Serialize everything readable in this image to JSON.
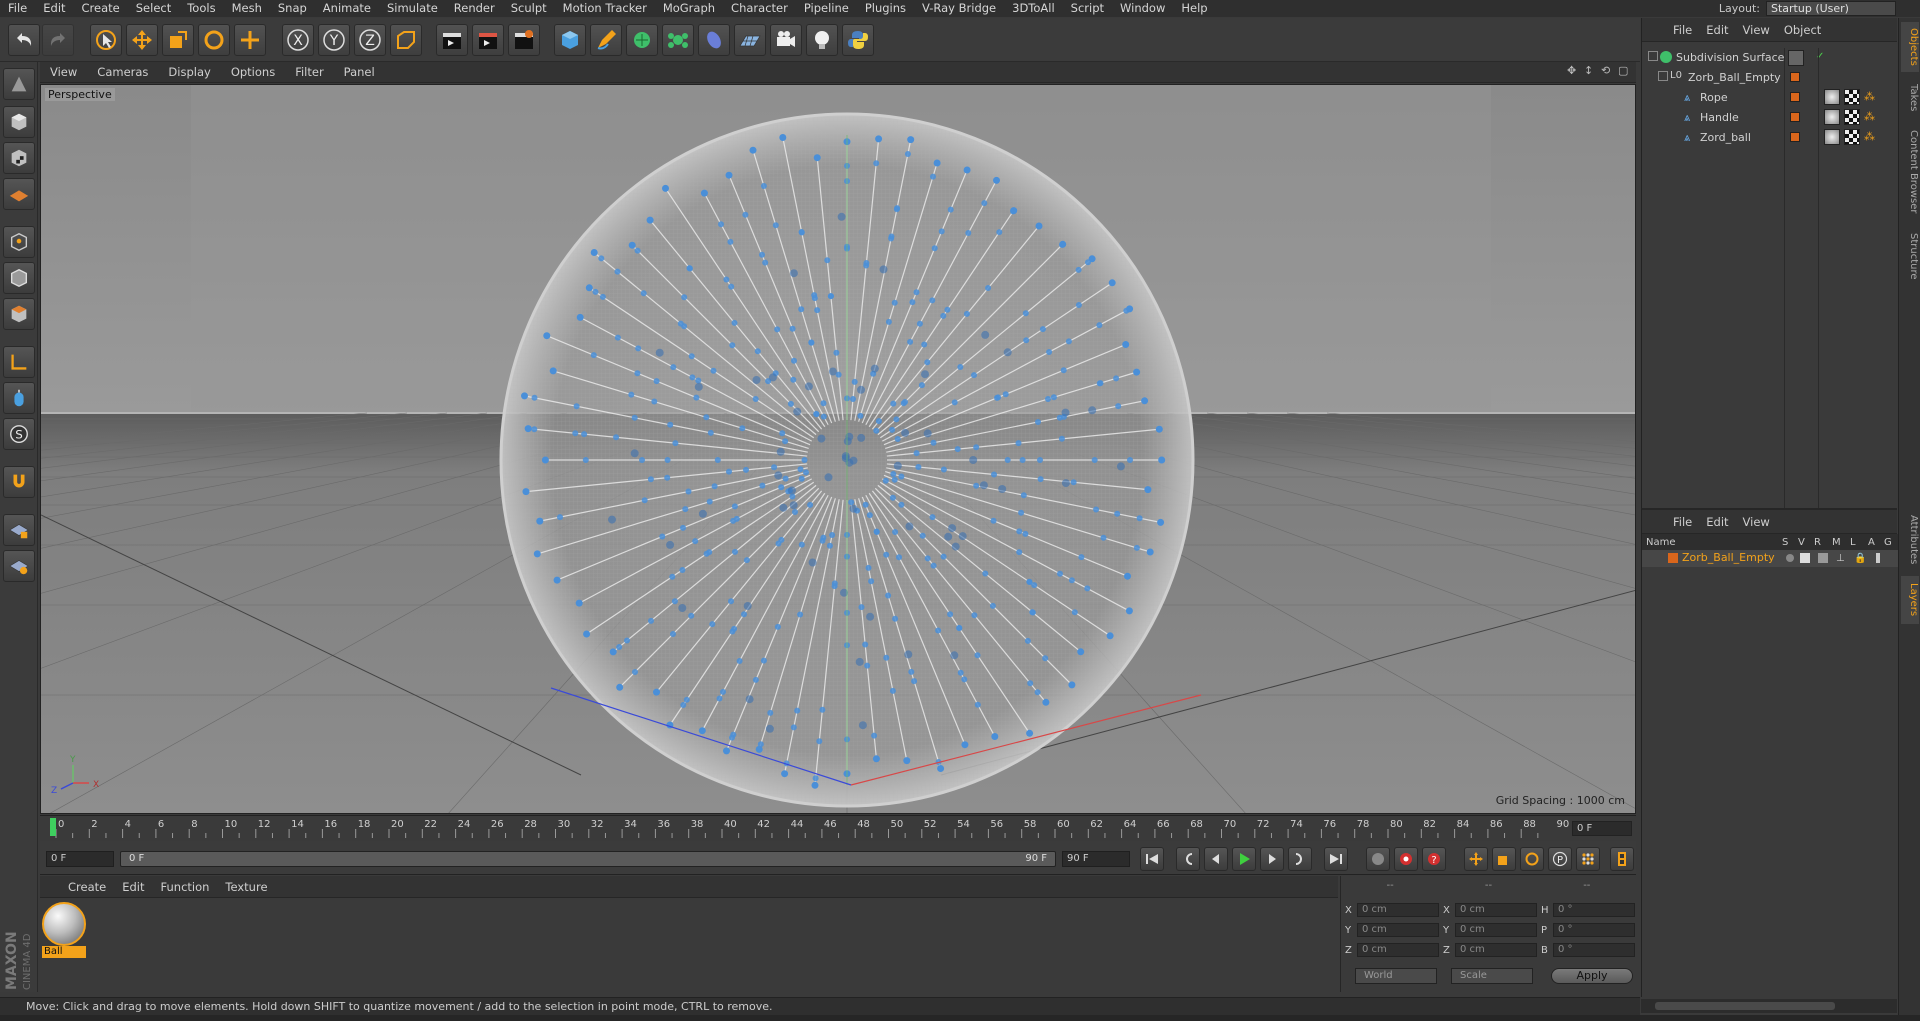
{
  "menubar": {
    "items": [
      "File",
      "Edit",
      "Create",
      "Select",
      "Tools",
      "Mesh",
      "Snap",
      "Animate",
      "Simulate",
      "Render",
      "Sculpt",
      "Motion Tracker",
      "MoGraph",
      "Character",
      "Pipeline",
      "Plugins",
      "V-Ray Bridge",
      "3DToAll",
      "Script",
      "Window",
      "Help"
    ],
    "layout_label": "Layout:",
    "layout_value": "Startup (User)"
  },
  "viewport": {
    "menu": [
      "View",
      "Cameras",
      "Display",
      "Options",
      "Filter",
      "Panel"
    ],
    "label": "Perspective",
    "grid_spacing": "Grid Spacing : 1000 cm",
    "axis_y": "Y",
    "axis_z": "Z",
    "axis_x": "X"
  },
  "timeline": {
    "ticks": [
      "0",
      "2",
      "4",
      "6",
      "8",
      "10",
      "12",
      "14",
      "16",
      "18",
      "20",
      "22",
      "24",
      "26",
      "28",
      "30",
      "32",
      "34",
      "36",
      "38",
      "40",
      "42",
      "44",
      "46",
      "48",
      "50",
      "52",
      "54",
      "56",
      "58",
      "60",
      "62",
      "64",
      "66",
      "68",
      "70",
      "72",
      "74",
      "76",
      "78",
      "80",
      "82",
      "84",
      "86",
      "88",
      "90"
    ],
    "current_frame": "0 F"
  },
  "transport": {
    "start_field": "0 F",
    "slider_start": "0 F",
    "slider_end": "90 F",
    "end_field": "90 F"
  },
  "materials": {
    "menu": [
      "Create",
      "Edit",
      "Function",
      "Texture"
    ],
    "items": [
      {
        "name": "Ball"
      }
    ]
  },
  "coordinates": {
    "headers": [
      "--",
      "--",
      "--"
    ],
    "rows": [
      {
        "l1": "X",
        "v1": "0 cm",
        "l2": "X",
        "v2": "0 cm",
        "l3": "H",
        "v3": "0 °"
      },
      {
        "l1": "Y",
        "v1": "0 cm",
        "l2": "Y",
        "v2": "0 cm",
        "l3": "P",
        "v3": "0 °"
      },
      {
        "l1": "Z",
        "v1": "0 cm",
        "l2": "Z",
        "v2": "0 cm",
        "l3": "B",
        "v3": "0 °"
      }
    ],
    "mode_world": "World",
    "mode_scale": "Scale",
    "apply": "Apply"
  },
  "brand": {
    "maxon": "MAXON",
    "cinema": "CINEMA 4D"
  },
  "statusbar": {
    "text": "Move: Click and drag to move elements. Hold down SHIFT to quantize movement / add to the selection in point mode, CTRL to remove."
  },
  "objects": {
    "menu": [
      "File",
      "Edit",
      "View",
      "Object"
    ],
    "items": [
      {
        "name": "Subdivision Surface"
      },
      {
        "name": "Zorb_Ball_Empty"
      },
      {
        "name": "Rope"
      },
      {
        "name": "Handle"
      },
      {
        "name": "Zord_ball"
      }
    ]
  },
  "layers": {
    "menu": [
      "File",
      "Edit",
      "View"
    ],
    "columns": [
      "Name",
      "S",
      "V",
      "R",
      "M",
      "L",
      "A",
      "G"
    ],
    "items": [
      {
        "name": "Zorb_Ball_Empty"
      }
    ]
  },
  "right_tabs": [
    "Objects",
    "Takes",
    "Content Browser",
    "Structure",
    "Attributes",
    "Layers"
  ],
  "colors": {
    "accent": "#f3a21a",
    "viewport_bg": "#8d8d8d",
    "point": "#4a8fd8",
    "layer_orange": "#d9661c"
  }
}
